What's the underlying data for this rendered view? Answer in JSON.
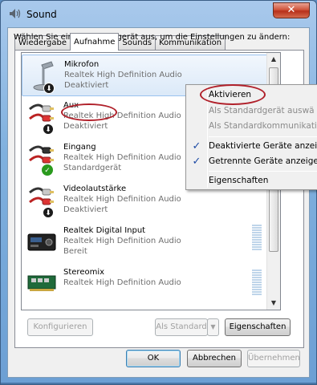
{
  "window": {
    "title": "Sound",
    "close_glyph": "✕"
  },
  "tabs": [
    {
      "label": "Wiedergabe",
      "active": false
    },
    {
      "label": "Aufnahme",
      "active": true
    },
    {
      "label": "Sounds",
      "active": false
    },
    {
      "label": "Kommunikation",
      "active": false
    }
  ],
  "instruction": "Wählen Sie ein Aufnahmegerät aus, um die Einstellungen zu ändern:",
  "devices": [
    {
      "name": "Mikrofon",
      "driver": "Realtek High Definition Audio",
      "status": "Deaktiviert",
      "icon": "microphone-icon",
      "badge": "disabled-down-arrow-icon"
    },
    {
      "name": "Aux",
      "driver": "Realtek High Definition Audio",
      "status": "Deaktiviert",
      "icon": "audio-cable-icon",
      "badge": "disabled-down-arrow-icon"
    },
    {
      "name": "Eingang",
      "driver": "Realtek High Definition Audio",
      "status": "Standardgerät",
      "icon": "line-in-cable-icon",
      "badge": "default-check-icon"
    },
    {
      "name": "Videolautstärke",
      "driver": "Realtek High Definition Audio",
      "status": "Deaktiviert",
      "icon": "audio-cable-icon",
      "badge": "disabled-down-arrow-icon"
    },
    {
      "name": "Realtek Digital Input",
      "driver": "Realtek High Definition Audio",
      "status": "Bereit",
      "icon": "digital-input-device-icon",
      "badge": ""
    },
    {
      "name": "Stereomix",
      "driver": "Realtek High Definition Audio",
      "status": "",
      "icon": "sound-card-icon",
      "badge": ""
    }
  ],
  "context_menu": {
    "items": [
      {
        "label": "Aktivieren",
        "enabled": true,
        "checked": false
      },
      {
        "label": "Als Standardgerät auswä",
        "enabled": false,
        "checked": false
      },
      {
        "label": "Als Standardkommunikati",
        "enabled": false,
        "checked": false
      },
      {
        "separator": true
      },
      {
        "label": "Deaktivierte Geräte anzeig",
        "enabled": true,
        "checked": true
      },
      {
        "label": "Getrennte Geräte anzeige",
        "enabled": true,
        "checked": true
      },
      {
        "separator": true
      },
      {
        "label": "Eigenschaften",
        "enabled": true,
        "checked": false
      }
    ]
  },
  "buttons": {
    "configure": "Konfigurieren",
    "set_default": "Als Standard",
    "properties": "Eigenschaften",
    "ok": "OK",
    "cancel": "Abbrechen",
    "apply": "Übernehmen"
  },
  "colors": {
    "highlight_oval": "#b0202a",
    "selection": "#dbe9f8",
    "default_check": "#2a9a1d"
  }
}
